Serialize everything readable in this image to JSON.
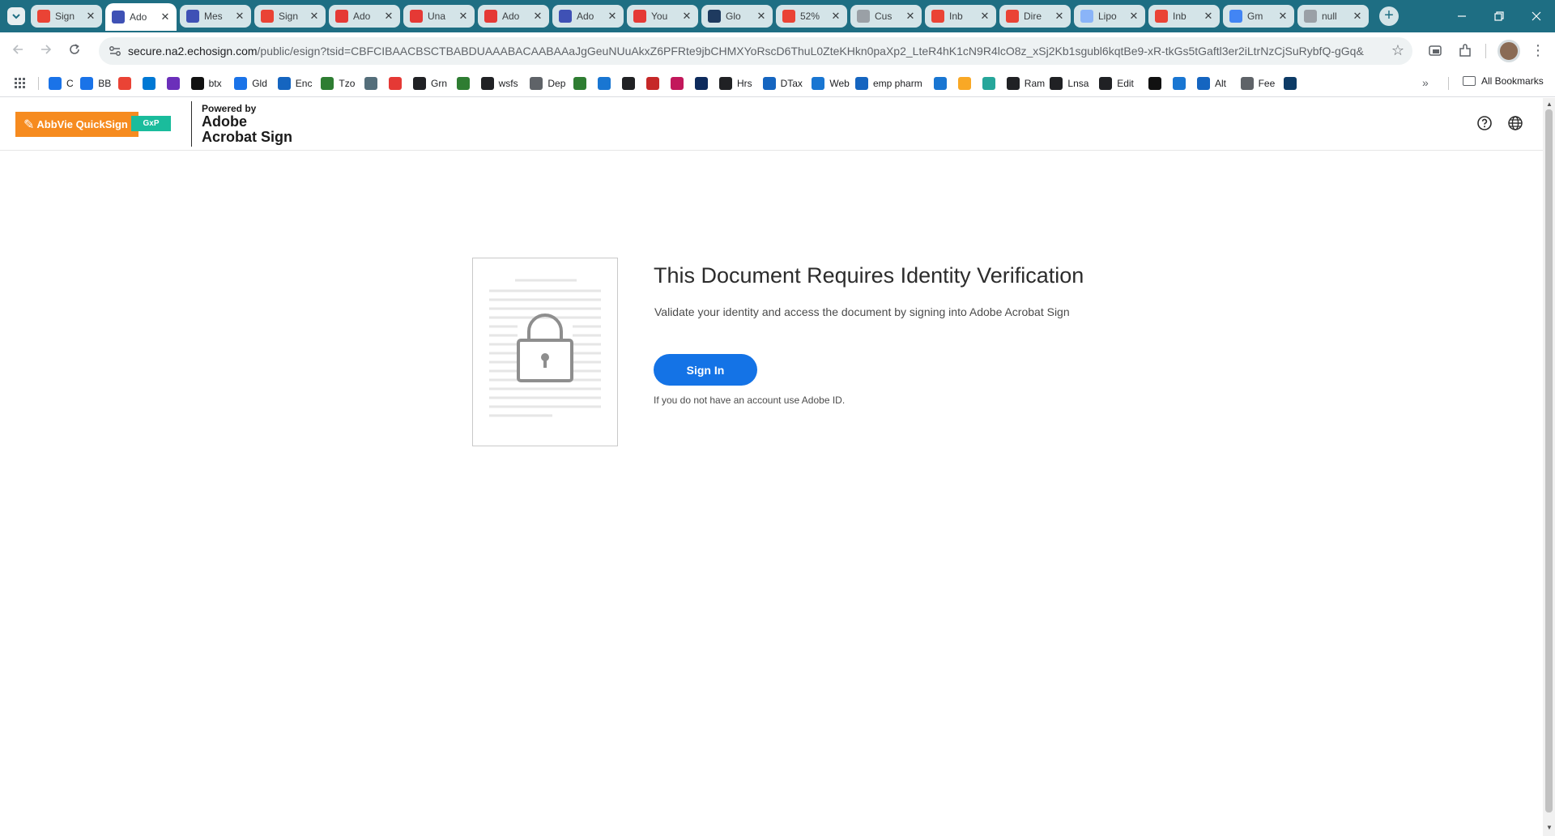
{
  "browser": {
    "tabs": [
      {
        "label": "Sign",
        "favicon_color": "#ea4335"
      },
      {
        "label": "Ado",
        "favicon_color": "#3f51b5",
        "active": true
      },
      {
        "label": "Mes",
        "favicon_color": "#3f51b5"
      },
      {
        "label": "Sign",
        "favicon_color": "#ea4335"
      },
      {
        "label": "Ado",
        "favicon_color": "#e53935"
      },
      {
        "label": "Una",
        "favicon_color": "#e53935"
      },
      {
        "label": "Ado",
        "favicon_color": "#e53935"
      },
      {
        "label": "Ado",
        "favicon_color": "#3f51b5"
      },
      {
        "label": "You",
        "favicon_color": "#e53935"
      },
      {
        "label": "Glo",
        "favicon_color": "#1e3a5f"
      },
      {
        "label": "52%",
        "favicon_color": "#ea4335"
      },
      {
        "label": "Cus",
        "favicon_color": "#9aa0a6"
      },
      {
        "label": "Inb",
        "favicon_color": "#ea4335"
      },
      {
        "label": "Dire",
        "favicon_color": "#ea4335"
      },
      {
        "label": "Lipo",
        "favicon_color": "#8ab4f8"
      },
      {
        "label": "Inb",
        "favicon_color": "#ea4335"
      },
      {
        "label": "Gm",
        "favicon_color": "#4285f4"
      },
      {
        "label": "null",
        "favicon_color": "#9aa0a6"
      }
    ],
    "url_host": "secure.na2.echosign.com",
    "url_path": "/public/esign?tsid=CBFCIBAACBSCTBABDUAAABACAABAAaJgGeuNUuAkxZ6PFRte9jbCHMXYoRscD6ThuL0ZteKHkn0paXp2_LteR4hK1cN9R4lcO8z_xSj2Kb1sgubl6kqtBe9-xR-tkGs5tGaftl3er2iLtrNzCjSuRybfQ-gGq&",
    "bookmarks": [
      {
        "label": "C",
        "color": "#1a73e8"
      },
      {
        "label": "BB",
        "color": "#1a73e8"
      },
      {
        "label": "",
        "color": "#ea4335"
      },
      {
        "label": "",
        "color": "#0078d4"
      },
      {
        "label": "",
        "color": "#6b2fba"
      },
      {
        "label": "btx",
        "color": "#111111"
      },
      {
        "label": "Gld",
        "color": "#1a73e8"
      },
      {
        "label": "Enc",
        "color": "#1565c0"
      },
      {
        "label": "Tzo",
        "color": "#2e7d32"
      },
      {
        "label": "",
        "color": "#546e7a"
      },
      {
        "label": "",
        "color": "#e53935"
      },
      {
        "label": "Grn",
        "color": "#202124"
      },
      {
        "label": "",
        "color": "#2e7d32"
      },
      {
        "label": "wsfs",
        "color": "#202124"
      },
      {
        "label": "Dep",
        "color": "#5f6368"
      },
      {
        "label": "",
        "color": "#2e7d32"
      },
      {
        "label": "",
        "color": "#1976d2"
      },
      {
        "label": "",
        "color": "#202124"
      },
      {
        "label": "",
        "color": "#c62828"
      },
      {
        "label": "",
        "color": "#c2185b"
      },
      {
        "label": "",
        "color": "#0d2a5c"
      },
      {
        "label": "Hrs",
        "color": "#202124"
      },
      {
        "label": "DTax",
        "color": "#1565c0"
      },
      {
        "label": "Web",
        "color": "#1976d2"
      },
      {
        "label": "emp pharm",
        "color": "#1565c0"
      },
      {
        "label": "",
        "color": "#1976d2"
      },
      {
        "label": "",
        "color": "#f9a825"
      },
      {
        "label": "",
        "color": "#26a69a"
      },
      {
        "label": "Ram",
        "color": "#202124"
      },
      {
        "label": "Lnsa",
        "color": "#202124"
      },
      {
        "label": "Edit",
        "color": "#202124"
      },
      {
        "label": "",
        "color": "#111111"
      },
      {
        "label": "",
        "color": "#1976d2"
      },
      {
        "label": "Alt",
        "color": "#1565c0"
      },
      {
        "label": "Fee",
        "color": "#5f6368"
      },
      {
        "label": "",
        "color": "#0d3b66"
      }
    ],
    "all_bookmarks_label": "All Bookmarks"
  },
  "header": {
    "quicksign_label": "AbbVie QuickSign",
    "gxp_label": "GxP",
    "powered_by": "Powered by",
    "brand_line1": "Adobe",
    "brand_line2": "Acrobat Sign"
  },
  "main": {
    "title": "This Document Requires Identity Verification",
    "subtitle": "Validate your identity and access the document by signing into Adobe Acrobat Sign",
    "signin_label": "Sign In",
    "help_text": "If you do not have an account use Adobe ID."
  },
  "colors": {
    "tab_strip": "#1e6e83",
    "signin_button": "#1473e6",
    "quicksign_orange": "#f68b1f",
    "gxp_teal": "#1abc9c"
  }
}
